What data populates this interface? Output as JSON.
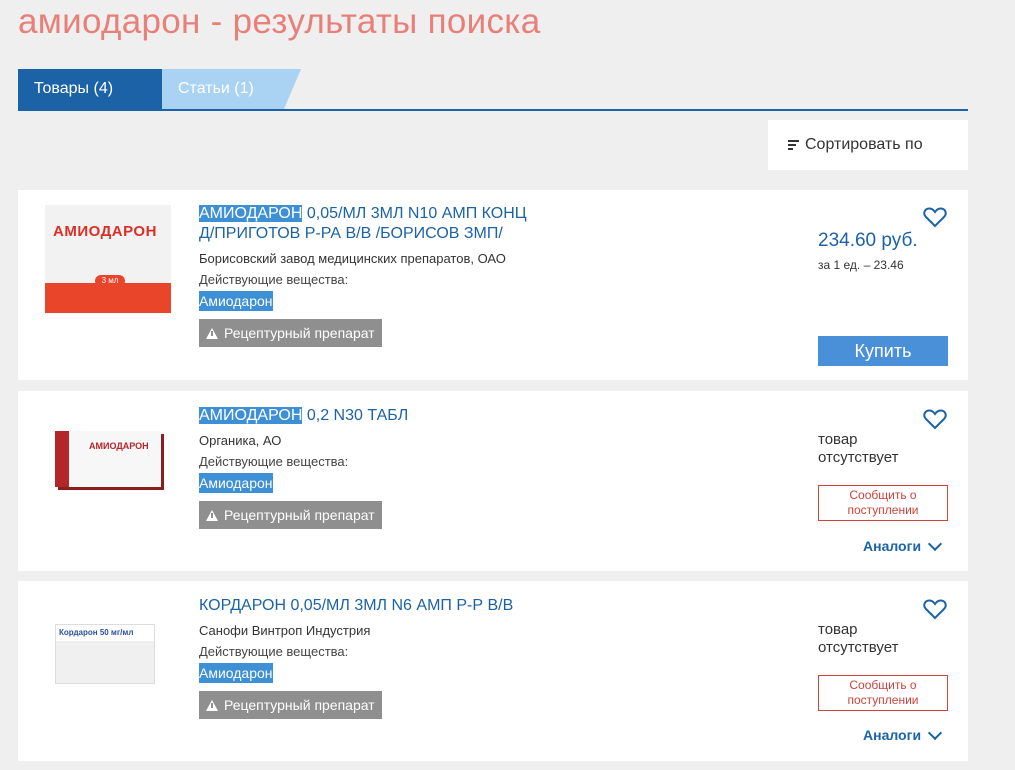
{
  "page": {
    "title": "амиодарон - результаты поиска"
  },
  "tabs": [
    {
      "label": "Товары (4)",
      "active": true
    },
    {
      "label": "Статьи (1)",
      "active": false
    }
  ],
  "sort": {
    "label": "Сортировать по"
  },
  "colors": {
    "primary": "#1b63a6",
    "highlight": "#3d8fd6",
    "title_salmon": "#e8807a",
    "notify_red": "#d0423a",
    "rx_badge": "#8f8f8f"
  },
  "products": [
    {
      "title_highlight": "АМИОДАРОН",
      "title_rest": " 0,05/МЛ 3МЛ N10 АМП КОНЦ Д/ПРИГОТОВ Р-РА В/В /БОРИСОВ ЗМП/",
      "maker": "Борисовский завод медицинских препаратов, ОАО",
      "active_label": "Действующие вещества:",
      "active_value": "Амиодарон",
      "rx_label": "Рецептурный препарат",
      "price": "234.60 руб.",
      "unit_price": "за 1 ед. – 23.46",
      "buy_label": "Купить",
      "image_text": "АМИОДАРОН",
      "image_pill": "3 мл"
    },
    {
      "title_highlight": "АМИОДАРОН",
      "title_rest": " 0,2 N30 ТАБЛ",
      "maker": "Органика, АО",
      "active_label": "Действующие вещества:",
      "active_value": "Амиодарон",
      "rx_label": "Рецептурный препарат",
      "absent_label": "товар отсутствует",
      "notify_label": "Сообщить о поступлении",
      "analogs_label": "Аналоги",
      "image_text": "АМИОДАРОН"
    },
    {
      "title": "КОРДАРОН 0,05/МЛ 3МЛ N6 АМП Р-Р В/В",
      "maker": "Санофи Винтроп Индустрия",
      "active_label": "Действующие вещества:",
      "active_value": "Амиодарон",
      "rx_label": "Рецептурный препарат",
      "absent_label": "товар отсутствует",
      "notify_label": "Сообщить о поступлении",
      "analogs_label": "Аналоги",
      "image_text": "Кордарон 50 мг/мл"
    }
  ],
  "icons": {
    "favorite": "heart-icon",
    "sort": "sort-icon",
    "warning": "warning-icon",
    "expand": "chevron-down-icon"
  }
}
